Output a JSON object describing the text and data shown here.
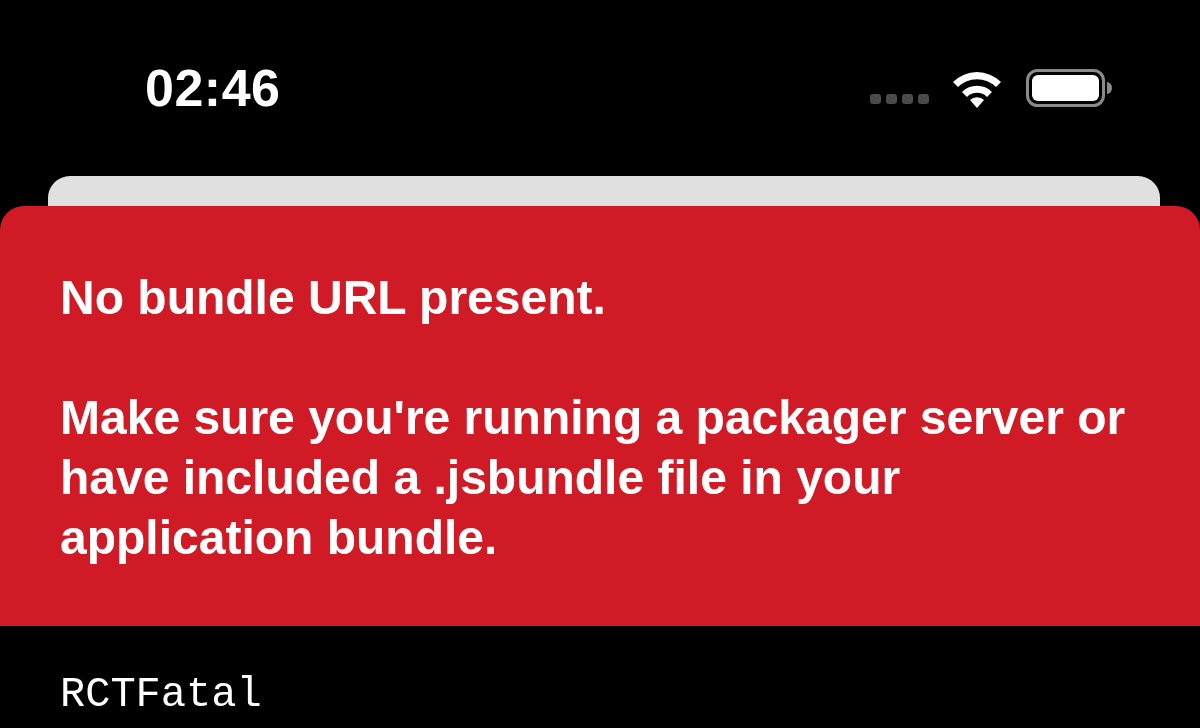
{
  "status_bar": {
    "time": "02:46"
  },
  "error": {
    "title": "No bundle URL present.",
    "message": "Make sure you're running a packager server or\nhave included a .jsbundle file in your\napplication bundle."
  },
  "stack": [
    "RCTFatal"
  ]
}
